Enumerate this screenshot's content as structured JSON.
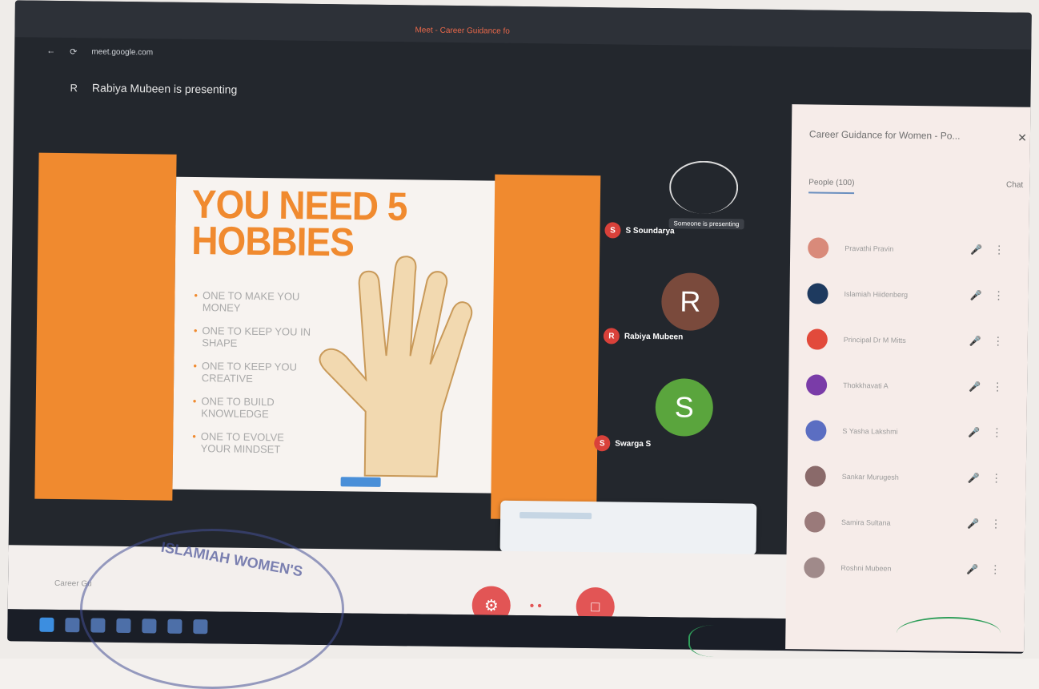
{
  "browser": {
    "tab_title": "Meet - Career Guidance fo",
    "url": "meet.google.com"
  },
  "meeting": {
    "presenter_avatar": "R",
    "presenting_text": "Rabiya Mubeen is presenting",
    "meeting_name": "Career Gu"
  },
  "slide": {
    "title": "YOU NEED 5 HOBBIES",
    "bullets": [
      "ONE TO MAKE YOU MONEY",
      "ONE TO KEEP YOU IN SHAPE",
      "ONE TO KEEP YOU CREATIVE",
      "ONE TO BUILD KNOWLEDGE",
      "ONE TO EVOLVE YOUR MINDSET"
    ]
  },
  "tiles": [
    {
      "initial": "S",
      "name": "S Soundarya",
      "badge": "Someone is presenting"
    },
    {
      "initial": "R",
      "name": "Rabiya Mubeen",
      "avatar": "R",
      "color": "#7a4a3c"
    },
    {
      "initial": "S",
      "name": "Swarga S",
      "avatar": "S",
      "color": "#5aa53d"
    }
  ],
  "panel": {
    "title": "Career Guidance for Women - Po...",
    "people_tab": "People (100)",
    "chat_tab": "Chat",
    "participants": [
      {
        "name": "Pravathi Pravin",
        "color": "#d98a7a"
      },
      {
        "name": "Islamiah Hiidenberg",
        "color": "#1e3a5f"
      },
      {
        "name": "Principal Dr M Mitts",
        "color": "#e24a3b"
      },
      {
        "name": "Thokkhavati A",
        "color": "#7a3ca8"
      },
      {
        "name": "S Yasha Lakshmi",
        "color": "#5b6ec2"
      },
      {
        "name": "Sankar Murugesh",
        "color": "#8a6a6a"
      },
      {
        "name": "Samira Sultana",
        "color": "#9a7a7a"
      },
      {
        "name": "Roshni Mubeen",
        "color": "#a08a8a"
      }
    ]
  },
  "stamp_text": "ISLAMIAH WOMEN'S"
}
